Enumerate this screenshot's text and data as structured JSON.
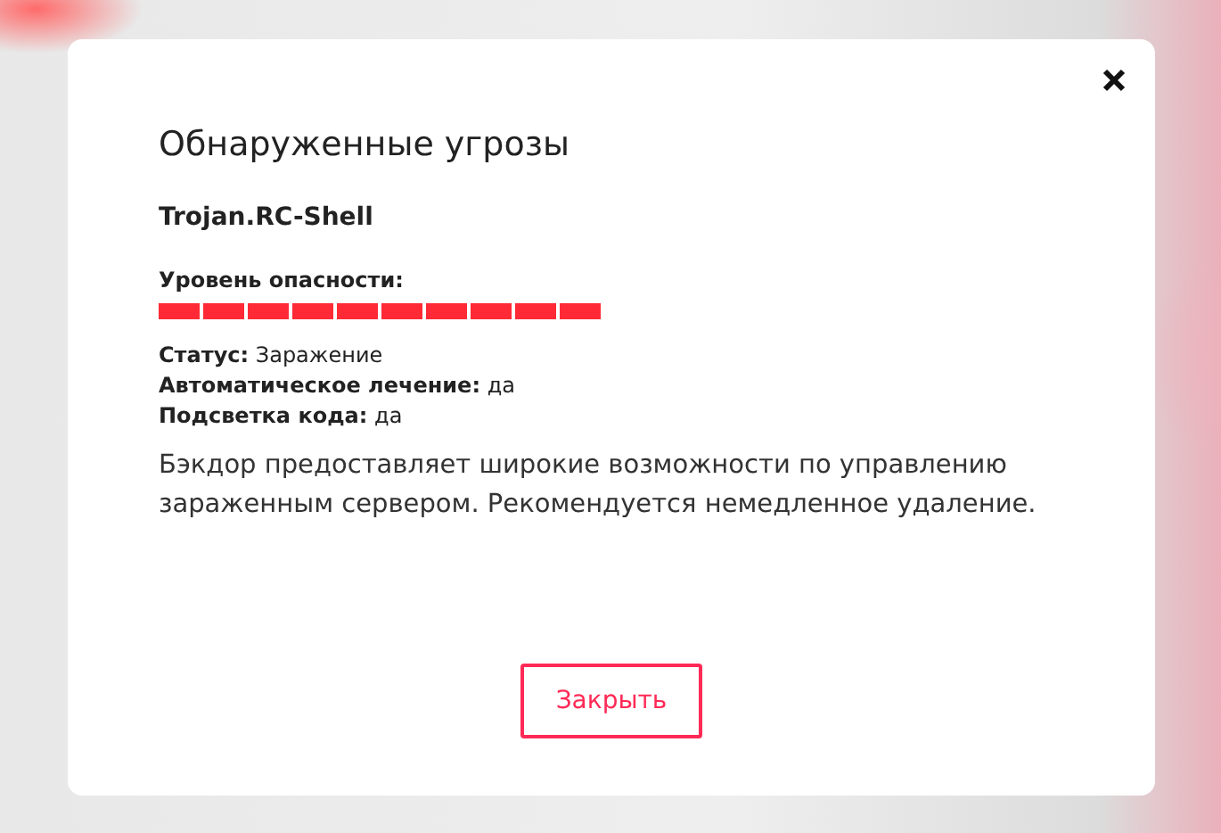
{
  "dialog": {
    "title": "Обнаруженные угрозы",
    "threat_name": "Trojan.RC-Shell",
    "danger": {
      "label": "Уровень опасности:",
      "level": 1
    },
    "details": [
      {
        "label": "Статус:",
        "value": "Заражение"
      },
      {
        "label": "Автоматическое лечение:",
        "value": "да"
      },
      {
        "label": "Подсветка кода:",
        "value": "да"
      }
    ],
    "description": "Бэкдор предоставляет широкие возможности по управлению зараженным сервером. Рекомендуется немедленное удаление.",
    "button": "Закрыть"
  }
}
